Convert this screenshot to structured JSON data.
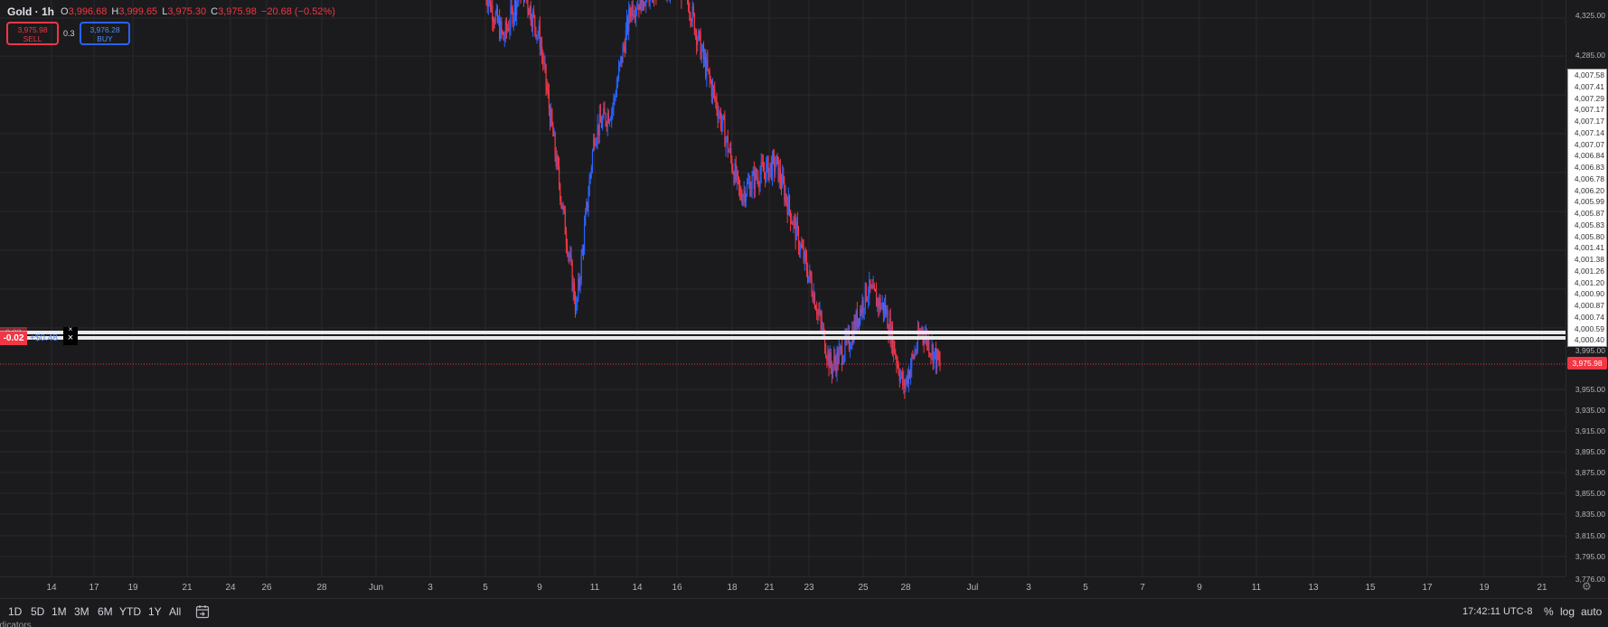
{
  "symbol": {
    "name": "Gold",
    "interval": "1h"
  },
  "ohlc": {
    "o_key": "O",
    "o_val": "3,996.68",
    "h_key": "H",
    "h_val": "3,999.65",
    "l_key": "L",
    "l_val": "3,975.30",
    "c_key": "C",
    "c_val": "3,975.98",
    "change": "−20.68 (−0.52%)"
  },
  "trade": {
    "sell_price": "3,975.98",
    "sell_label": "SELL",
    "quantity": "0.3",
    "buy_price": "3,976.28",
    "buy_label": "BUY"
  },
  "position": {
    "qty_back": "-0.02",
    "qty": "-0.02",
    "pnl_back": "+$0.21",
    "pnl": "+$0.48",
    "close_glyph": "×"
  },
  "price_axis": {
    "top_labels": [
      "4,325.00",
      "4,285.00"
    ],
    "order_stack": [
      "4,007.58",
      "4,007.41",
      "4,007.29",
      "4,007.17",
      "4,007.17",
      "4,007.14",
      "4,007.07",
      "4,006.84",
      "4,006.83",
      "4,006.78",
      "4,006.20",
      "4,005.99",
      "4,005.87",
      "4,005.83",
      "4,005.80",
      "4,001.41",
      "4,001.38",
      "4,001.26",
      "4,001.20",
      "4,000.90",
      "4,000.87",
      "4,000.74",
      "4,000.59",
      "4,000.40"
    ],
    "partial_label": "3,995.00",
    "last_price": "3,975.98",
    "bottom_labels": [
      "3,955.00",
      "3,935.00",
      "3,915.00",
      "3,895.00",
      "3,875.00",
      "3,855.00",
      "3,835.00",
      "3,815.00",
      "3,795.00",
      "3,776.00"
    ]
  },
  "time_axis": {
    "labels": [
      "14",
      "17",
      "19",
      "21",
      "24",
      "26",
      "28",
      "Jun",
      "3",
      "5",
      "9",
      "11",
      "14",
      "16",
      "18",
      "21",
      "23",
      "25",
      "28",
      "Jul",
      "3",
      "5",
      "7",
      "9",
      "11",
      "13",
      "15",
      "17",
      "19",
      "21"
    ]
  },
  "bottom_bar": {
    "ranges": [
      "1D",
      "5D",
      "1M",
      "3M",
      "6M",
      "YTD",
      "1Y",
      "All"
    ],
    "clock": "17:42:11 UTC-8",
    "percent": "%",
    "log": "log",
    "auto": "auto",
    "indicator_peek": "ndicators"
  },
  "icons": {
    "goto_date": "calendar-goto-icon",
    "settings": "gear-icon"
  },
  "colors": {
    "up": "#2962ff",
    "down": "#f23645",
    "background": "#1b1b1d",
    "grid": "#2a2a2e"
  },
  "chart_data": {
    "type": "candlestick",
    "instrument": "Gold",
    "timeframe": "1h",
    "last_ohlc": {
      "open": 3996.68,
      "high": 3999.65,
      "low": 3975.3,
      "close": 3975.98
    },
    "path_points": [
      {
        "date": "Jun 6",
        "price": 4336
      },
      {
        "date": "Jun 7",
        "price": 4290
      },
      {
        "date": "Jun 8",
        "price": 4342
      },
      {
        "date": "Jun 9",
        "price": 4290
      },
      {
        "date": "Jun 10",
        "price": 4160
      },
      {
        "date": "Jun 11",
        "price": 4030
      },
      {
        "date": "Jun 12",
        "price": 4200
      },
      {
        "date": "Jun 13",
        "price": 4225
      },
      {
        "date": "Jun 14",
        "price": 4320
      },
      {
        "date": "Jun 15",
        "price": 4335
      },
      {
        "date": "Jun 16",
        "price": 4340
      },
      {
        "date": "Jun 17",
        "price": 4338
      },
      {
        "date": "Jun 18",
        "price": 4270
      },
      {
        "date": "Jun 19",
        "price": 4210
      },
      {
        "date": "Jun 20",
        "price": 4140
      },
      {
        "date": "Jun 21",
        "price": 4160
      },
      {
        "date": "Jun 22",
        "price": 4170
      },
      {
        "date": "Jun 23",
        "price": 4110
      },
      {
        "date": "Jun 24",
        "price": 4050
      },
      {
        "date": "Jun 25",
        "price": 3975
      },
      {
        "date": "Jun 26",
        "price": 4000
      },
      {
        "date": "Jun 27",
        "price": 4050
      },
      {
        "date": "Jun 28",
        "price": 4030
      },
      {
        "date": "Jun 29",
        "price": 3955
      },
      {
        "date": "Jun 30",
        "price": 4012
      },
      {
        "date": "Jul 1",
        "price": 3975.98
      }
    ]
  }
}
